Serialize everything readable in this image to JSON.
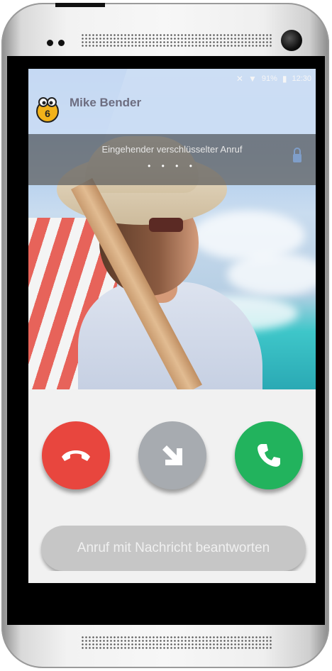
{
  "status_bar": {
    "battery": "91%",
    "time": "12:30",
    "icons": [
      "mute-icon",
      "wifi-icon",
      "battery-icon"
    ]
  },
  "caller": {
    "name": "Mike Bender",
    "app_icon": "app-mascot-icon"
  },
  "banner": {
    "text": "Eingehender verschlüsselter Anruf",
    "dots": "• • • •",
    "icon": "lock-icon"
  },
  "actions": {
    "decline_icon": "phone-hangup-icon",
    "redirect_icon": "arrow-down-right-icon",
    "accept_icon": "phone-icon",
    "message_label": "Anruf mit Nachricht beantworten"
  },
  "colors": {
    "decline": "#e8463e",
    "redirect": "#a7abb0",
    "accept": "#22b35d"
  }
}
